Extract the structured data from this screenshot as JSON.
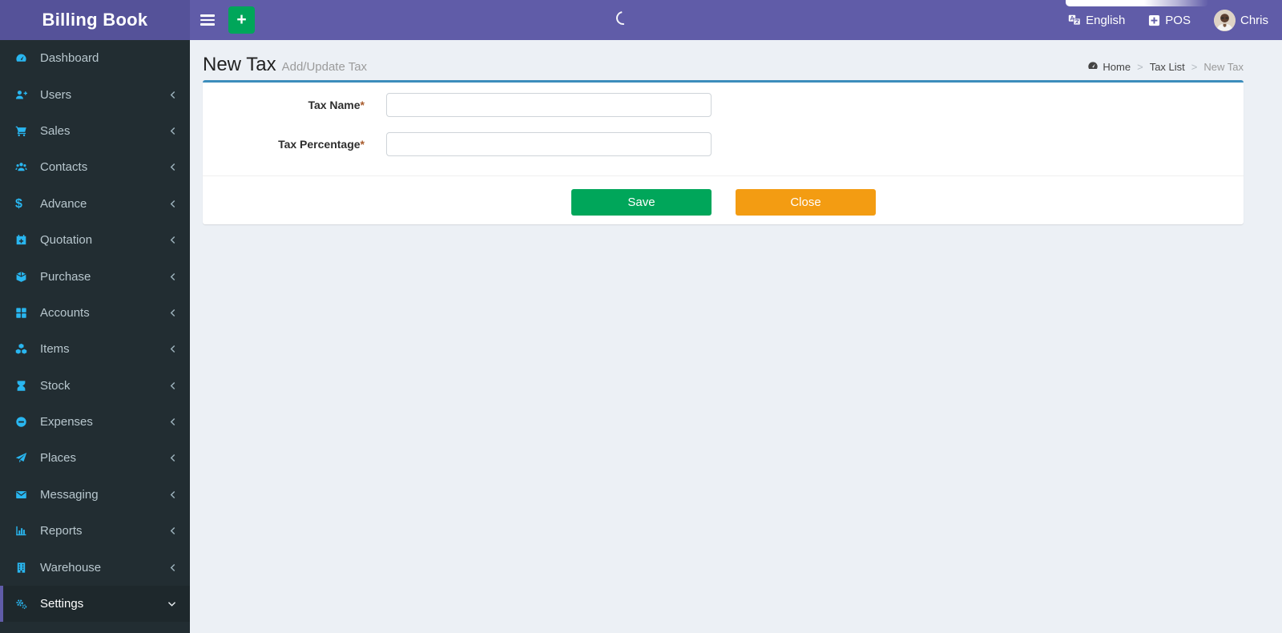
{
  "colors": {
    "navbar": "#605ca8",
    "logo_background": "#555299",
    "sidebar_background": "#222d32",
    "sidebar_active_background": "#1e282c",
    "sidebar_icon_accent": "#29b6f0",
    "content_background": "#ecf0f5",
    "card_top_border": "#3c8dbc",
    "save_button": "#00a65a",
    "close_button": "#f39c12"
  },
  "brand": {
    "title": "Billing Book"
  },
  "header": {
    "language_label": "English",
    "pos_label": "POS",
    "user_name": "Chris"
  },
  "sidebar": {
    "items": [
      {
        "label": "Dashboard",
        "icon": "dashboard-icon",
        "has_children": false
      },
      {
        "label": "Users",
        "icon": "user-plus-icon",
        "has_children": true
      },
      {
        "label": "Sales",
        "icon": "cart-icon",
        "has_children": true
      },
      {
        "label": "Contacts",
        "icon": "users-group-icon",
        "has_children": true
      },
      {
        "label": "Advance",
        "icon": "dollar-icon",
        "glyph": "$",
        "has_children": true
      },
      {
        "label": "Quotation",
        "icon": "calendar-plus-icon",
        "has_children": true
      },
      {
        "label": "Purchase",
        "icon": "cube-icon",
        "has_children": true
      },
      {
        "label": "Accounts",
        "icon": "grid-icon",
        "has_children": true
      },
      {
        "label": "Items",
        "icon": "cubes-icon",
        "has_children": true
      },
      {
        "label": "Stock",
        "icon": "hourglass-icon",
        "has_children": true
      },
      {
        "label": "Expenses",
        "icon": "minus-circle-icon",
        "has_children": true
      },
      {
        "label": "Places",
        "icon": "paper-plane-icon",
        "has_children": true
      },
      {
        "label": "Messaging",
        "icon": "envelope-icon",
        "has_children": true
      },
      {
        "label": "Reports",
        "icon": "bar-chart-icon",
        "has_children": true
      },
      {
        "label": "Warehouse",
        "icon": "building-icon",
        "has_children": true
      },
      {
        "label": "Settings",
        "icon": "gears-icon",
        "has_children": true,
        "active": true,
        "expanded": true
      }
    ]
  },
  "page": {
    "title": "New Tax",
    "subtitle": "Add/Update Tax",
    "breadcrumb": {
      "home": "Home",
      "parent": "Tax List",
      "current": "New Tax",
      "separator": ">"
    }
  },
  "form": {
    "required_mark": "*",
    "fields": [
      {
        "label": "Tax Name",
        "value": "",
        "required": true
      },
      {
        "label": "Tax Percentage",
        "value": "",
        "required": true
      }
    ],
    "save_label": "Save",
    "close_label": "Close"
  }
}
